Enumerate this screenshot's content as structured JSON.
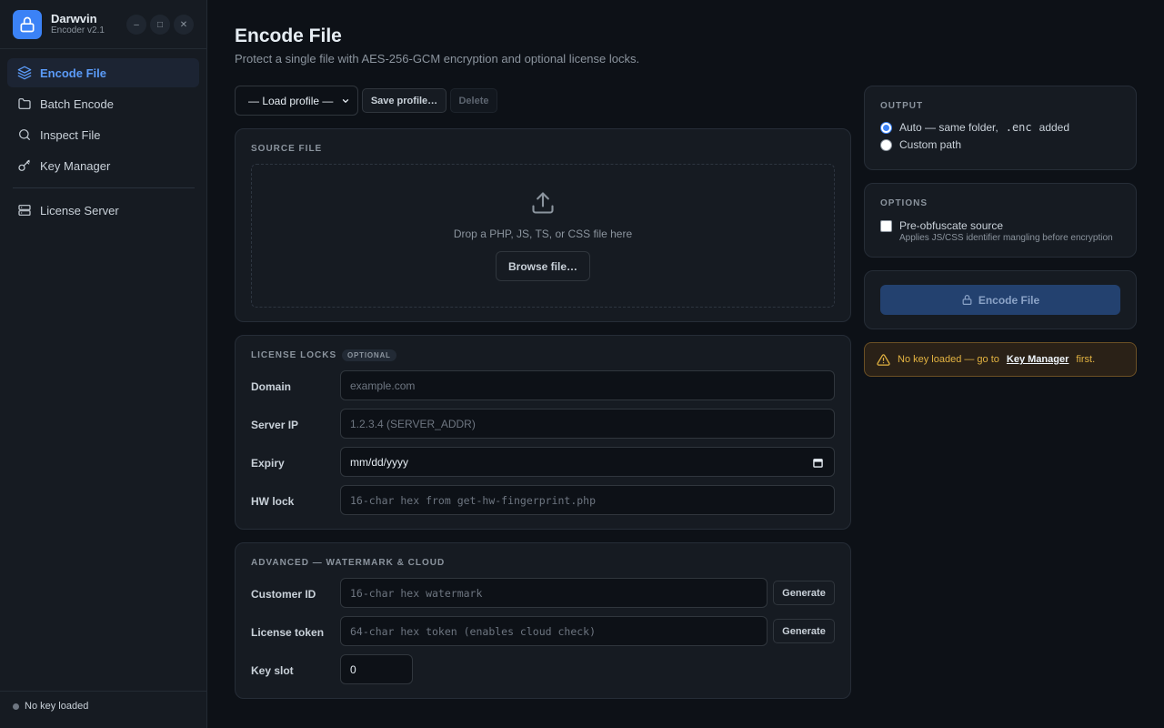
{
  "app": {
    "name": "Darwvin",
    "version": "Encoder v2.1"
  },
  "window_controls": {
    "minimize": "–",
    "maximize": "□",
    "close": "✕"
  },
  "sidebar": {
    "items": [
      {
        "label": "Encode File",
        "icon": "layers-icon",
        "active": true
      },
      {
        "label": "Batch Encode",
        "icon": "folder-icon"
      },
      {
        "label": "Inspect File",
        "icon": "search-icon"
      },
      {
        "label": "Key Manager",
        "icon": "key-icon"
      },
      {
        "label": "License Server",
        "icon": "server-icon"
      }
    ],
    "status": "No key loaded"
  },
  "page": {
    "title": "Encode File",
    "subtitle": "Protect a single file with AES-256-GCM encryption and optional license locks."
  },
  "profile": {
    "select_value": "— Load profile —",
    "save_label": "Save profile…",
    "delete_label": "Delete"
  },
  "source": {
    "title": "SOURCE FILE",
    "drop_text": "Drop a PHP, JS, TS, or CSS file here",
    "browse_label": "Browse file…"
  },
  "locks": {
    "title": "LICENSE LOCKS",
    "badge": "OPTIONAL",
    "fields": [
      {
        "label": "Domain",
        "placeholder": "example.com"
      },
      {
        "label": "Server IP",
        "placeholder": "1.2.3.4  (SERVER_ADDR)"
      },
      {
        "label": "Expiry",
        "value": "mm/dd/yyyy"
      },
      {
        "label": "HW lock",
        "placeholder": "16-char hex from get-hw-fingerprint.php"
      }
    ]
  },
  "advanced": {
    "title": "ADVANCED — WATERMARK & CLOUD",
    "customer_id": {
      "label": "Customer ID",
      "placeholder": "16-char hex watermark",
      "button": "Generate"
    },
    "license_token": {
      "label": "License token",
      "placeholder": "64-char hex token (enables cloud check)",
      "button": "Generate"
    },
    "key_slot": {
      "label": "Key slot",
      "value": "0"
    }
  },
  "output": {
    "title": "OUTPUT",
    "auto_prefix": "Auto — same folder,",
    "auto_ext": ".enc",
    "auto_suffix": "added",
    "custom": "Custom path",
    "selected": "auto"
  },
  "options": {
    "title": "OPTIONS",
    "preobfuscate": "Pre-obfuscate source",
    "preobfuscate_hint": "Applies JS/CSS identifier mangling before encryption",
    "preobfuscate_checked": false
  },
  "encode": {
    "label": "Encode File"
  },
  "warning": {
    "prefix": "No key loaded — go to",
    "link": "Key Manager",
    "suffix": "first."
  },
  "colors": {
    "accent": "#3b82f6",
    "warning": "#e3b341",
    "background": "#0d1117"
  }
}
